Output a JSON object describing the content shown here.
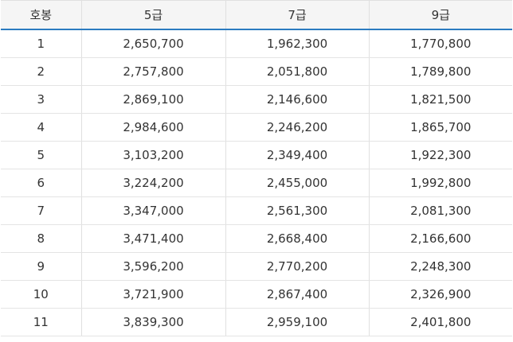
{
  "table": {
    "headers": [
      "호봉",
      "5급",
      "7급",
      "9급"
    ],
    "rows": [
      [
        "1",
        "2,650,700",
        "1,962,300",
        "1,770,800"
      ],
      [
        "2",
        "2,757,800",
        "2,051,800",
        "1,789,800"
      ],
      [
        "3",
        "2,869,100",
        "2,146,600",
        "1,821,500"
      ],
      [
        "4",
        "2,984,600",
        "2,246,200",
        "1,865,700"
      ],
      [
        "5",
        "3,103,200",
        "2,349,400",
        "1,922,300"
      ],
      [
        "6",
        "3,224,200",
        "2,455,000",
        "1,992,800"
      ],
      [
        "7",
        "3,347,000",
        "2,561,300",
        "2,081,300"
      ],
      [
        "8",
        "3,471,400",
        "2,668,400",
        "2,166,600"
      ],
      [
        "9",
        "3,596,200",
        "2,770,200",
        "2,248,300"
      ],
      [
        "10",
        "3,721,900",
        "2,867,400",
        "2,326,900"
      ],
      [
        "11",
        "3,839,300",
        "2,959,100",
        "2,401,800"
      ]
    ]
  },
  "colors": {
    "header_rule": "#2b7bc0",
    "header_bg": "#f5f5f5",
    "grid": "#e0e0e0"
  }
}
